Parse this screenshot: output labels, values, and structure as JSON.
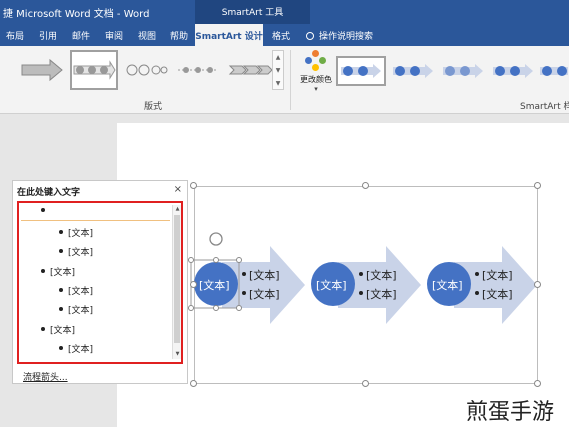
{
  "window": {
    "title": "捷 Microsoft Word 文档 - Word",
    "context_tab_group": "SmartArt 工具"
  },
  "tabs": [
    {
      "label": "布局",
      "active": false
    },
    {
      "label": "引用",
      "active": false
    },
    {
      "label": "邮件",
      "active": false
    },
    {
      "label": "审阅",
      "active": false
    },
    {
      "label": "视图",
      "active": false
    },
    {
      "label": "帮助",
      "active": false
    },
    {
      "label": "SmartArt 设计",
      "active": true
    },
    {
      "label": "格式",
      "active": false
    }
  ],
  "tell_me": {
    "label": "操作说明搜索",
    "icon": "lightbulb-icon"
  },
  "ribbon": {
    "layouts_group_label": "版式",
    "change_colors_label": "更改颜色",
    "styles_group_label": "SmartArt 样"
  },
  "text_pane": {
    "title": "在此处键入文字",
    "close_glyph": "×",
    "items": [
      {
        "level": 1,
        "text": ""
      },
      {
        "level": 2,
        "text": "[文本]"
      },
      {
        "level": 2,
        "text": "[文本]"
      },
      {
        "level": 1,
        "text": "[文本]"
      },
      {
        "level": 2,
        "text": "[文本]"
      },
      {
        "level": 2,
        "text": "[文本]"
      },
      {
        "level": 1,
        "text": "[文本]"
      },
      {
        "level": 2,
        "text": "[文本]"
      }
    ],
    "footer_link": "流程箭头..."
  },
  "smartart": {
    "nodes": [
      {
        "circle_text": "[文本]",
        "bullets": [
          "[文本]",
          "[文本]"
        ]
      },
      {
        "circle_text": "[文本]",
        "bullets": [
          "[文本]",
          "[文本]"
        ]
      },
      {
        "circle_text": "[文本]",
        "bullets": [
          "[文本]",
          "[文本]"
        ]
      }
    ],
    "circle_color": "#4472c4",
    "arrow_color": "#c9d3e8"
  },
  "watermark": "煎蛋手游",
  "colors": {
    "word_blue": "#2b579a",
    "highlight_red": "#e02020"
  }
}
